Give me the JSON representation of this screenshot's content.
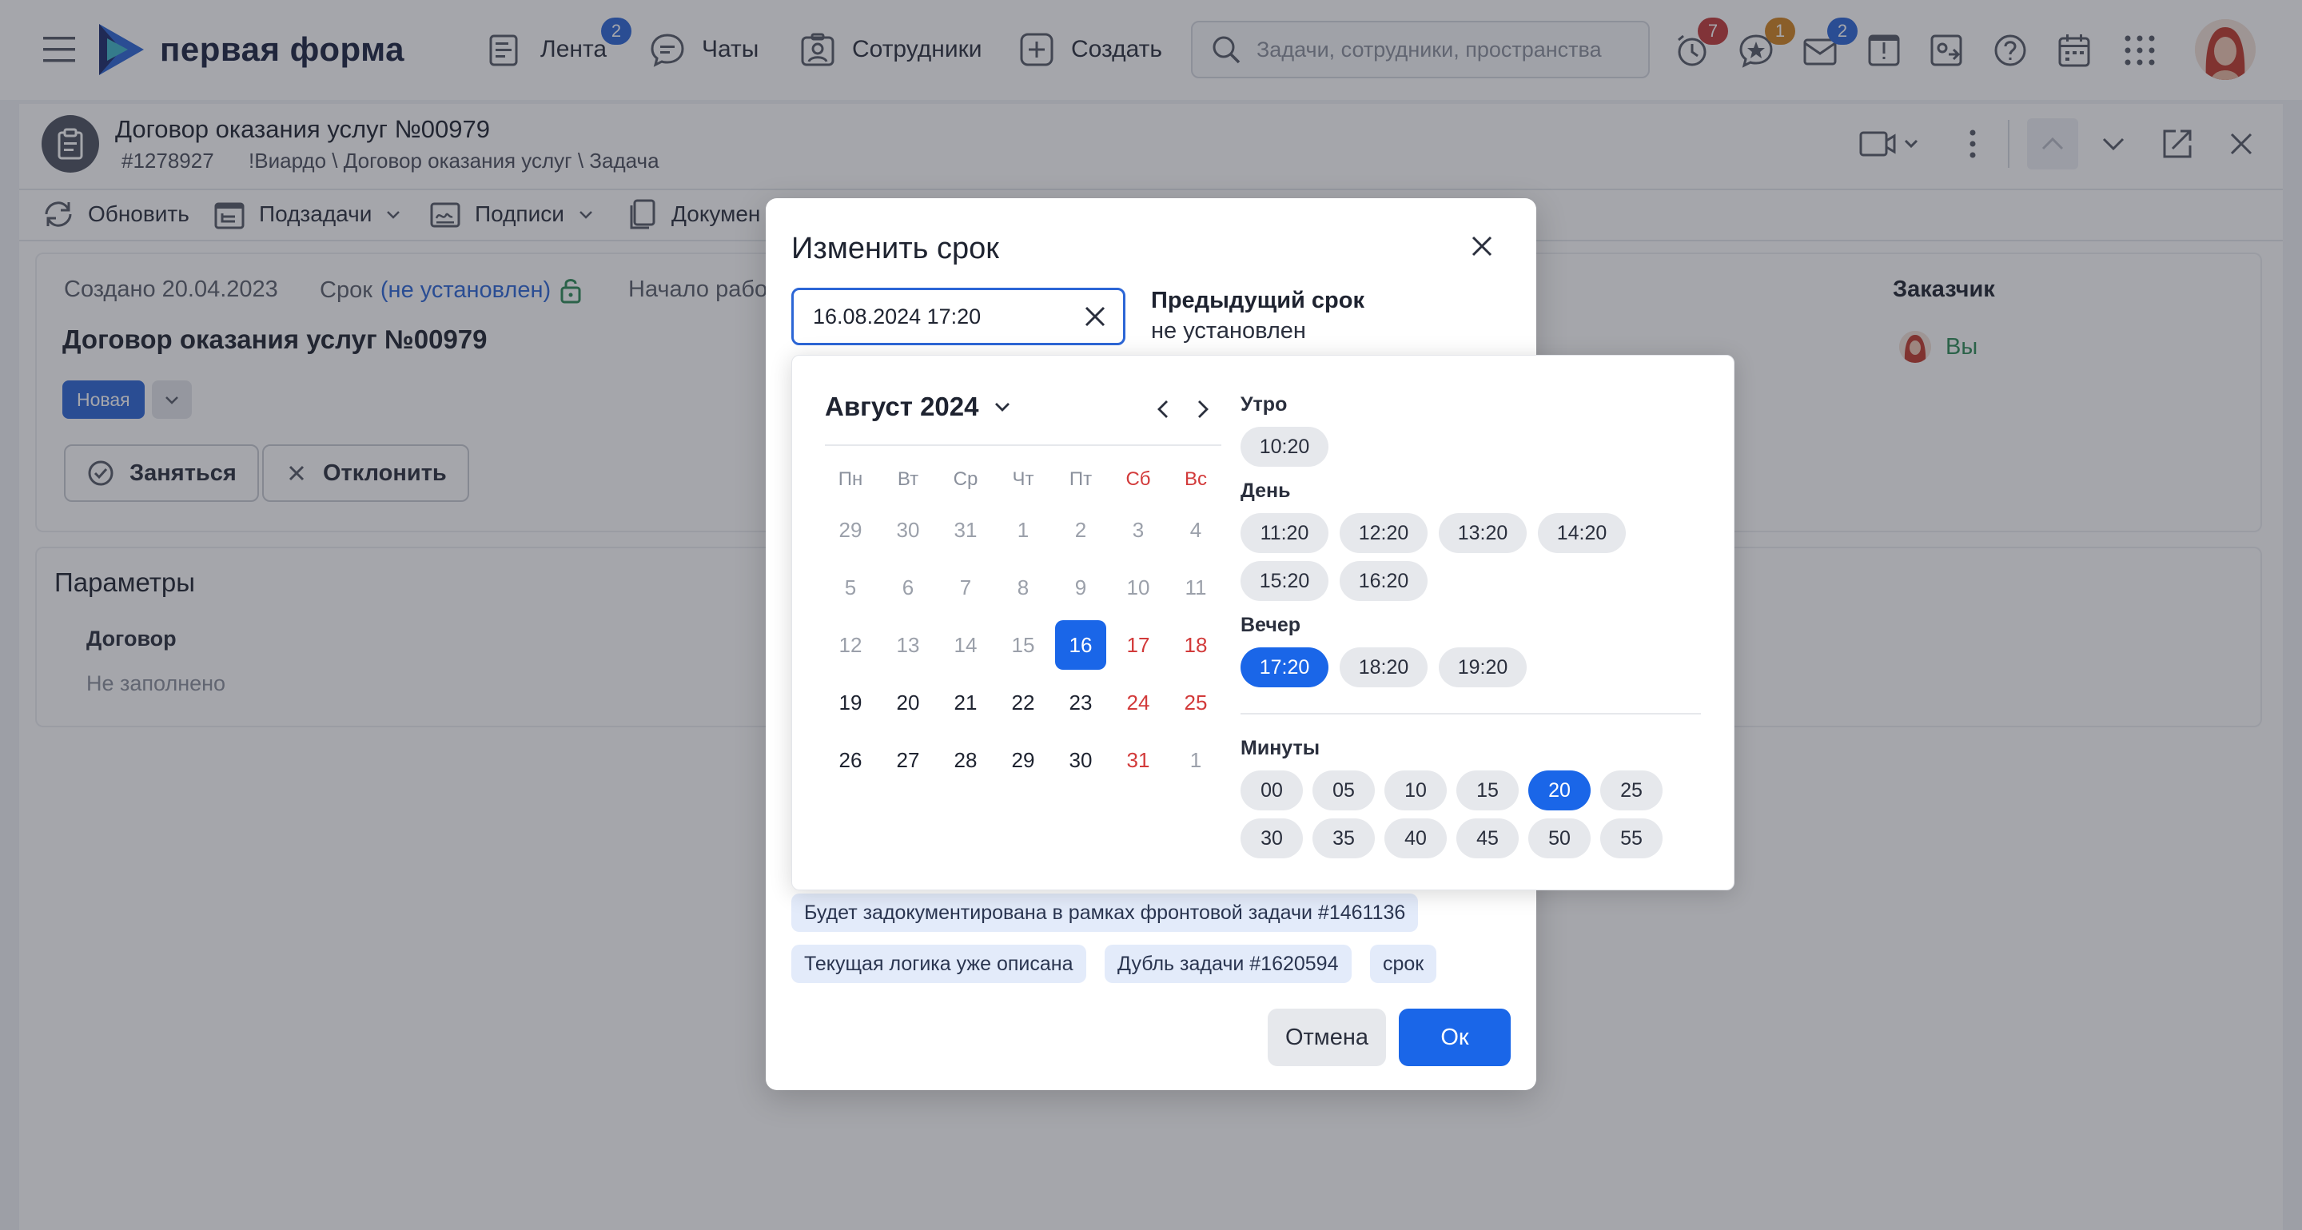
{
  "nav": {
    "logo_text": "первая форма",
    "items": [
      {
        "label": "Лента",
        "badge": "2"
      },
      {
        "label": "Чаты"
      },
      {
        "label": "Сотрудники"
      },
      {
        "label": "Создать"
      }
    ],
    "search_placeholder": "Задачи, сотрудники, пространства",
    "icon_badges": {
      "reminders": "7",
      "favorites": "1",
      "mail": "2"
    }
  },
  "task": {
    "title": "Договор оказания услуг №00979",
    "path": "#1278927      !Виардо \\ Договор оказания услуг \\ Задача"
  },
  "toolbar": {
    "refresh": "Обновить",
    "subtasks": "Подзадачи",
    "signatures": "Подписи",
    "documents": "Докумен"
  },
  "info": {
    "created": "Создано 20.04.2023",
    "deadline_label": "Срок",
    "deadline_value": "(не установлен)",
    "start": "Начало рабо",
    "main_title": "Договор оказания услуг №00979",
    "status": "Новая",
    "take_button": "Заняться",
    "reject_button": "Отклонить",
    "customer_label": "Заказчик",
    "customer_value": "Вы"
  },
  "params": {
    "title": "Параметры",
    "field": "Договор",
    "value": "Не заполнено"
  },
  "modal": {
    "title": "Изменить срок",
    "date_value": "16.08.2024 17:20",
    "prev_label": "Предыдущий срок",
    "prev_value": "не установлен",
    "chips": [
      "Будет задокументирована в рамках фронтовой задачи #1461136",
      "Текущая логика уже описана",
      "Дубль задачи #1620594",
      "срок"
    ],
    "cancel": "Отмена",
    "ok": "Ок"
  },
  "calendar": {
    "month": "Август 2024",
    "weekdays": [
      "Пн",
      "Вт",
      "Ср",
      "Чт",
      "Пт",
      "Сб",
      "Вс"
    ],
    "weeks": [
      [
        "29",
        "30",
        "31",
        "1",
        "2",
        "3",
        "4"
      ],
      [
        "5",
        "6",
        "7",
        "8",
        "9",
        "10",
        "11"
      ],
      [
        "12",
        "13",
        "14",
        "15",
        "16",
        "17",
        "18"
      ],
      [
        "19",
        "20",
        "21",
        "22",
        "23",
        "24",
        "25"
      ],
      [
        "26",
        "27",
        "28",
        "29",
        "30",
        "31",
        "1"
      ]
    ],
    "selected_day": "16"
  },
  "time": {
    "morning_label": "Утро",
    "morning": [
      "10:20"
    ],
    "day_label": "День",
    "day": [
      "11:20",
      "12:20",
      "13:20",
      "14:20",
      "15:20",
      "16:20"
    ],
    "evening_label": "Вечер",
    "evening": [
      "17:20",
      "18:20",
      "19:20"
    ],
    "selected_hour": "17:20",
    "minutes_label": "Минуты",
    "minutes": [
      "00",
      "05",
      "10",
      "15",
      "20",
      "25",
      "30",
      "35",
      "40",
      "45",
      "50",
      "55"
    ],
    "selected_minute": "20"
  },
  "colors": {
    "accent": "#1a66e8",
    "weekend": "#d23a3a",
    "customer": "#2e8b57"
  }
}
